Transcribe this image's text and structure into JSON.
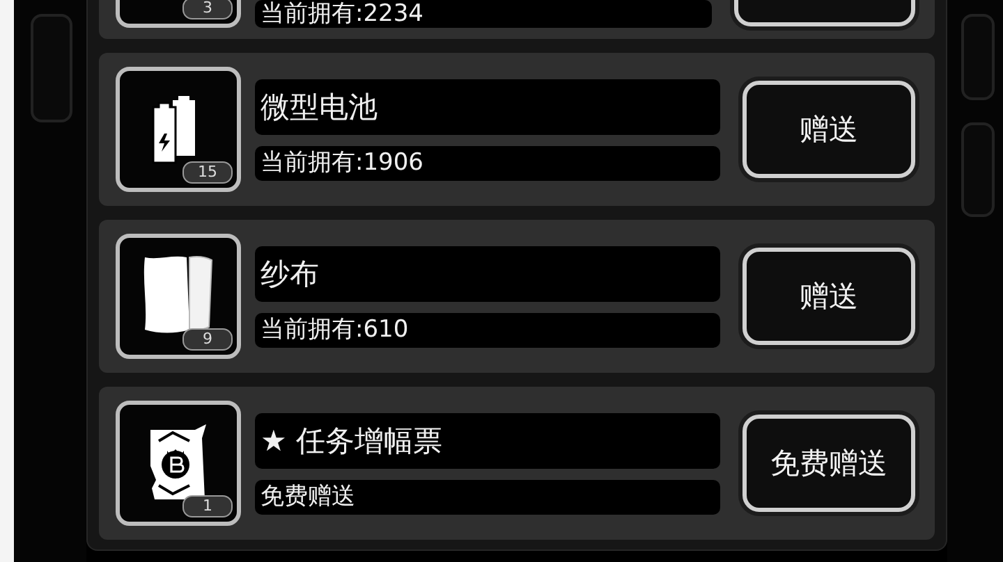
{
  "items": [
    {
      "kind": "partial",
      "owned": "当前拥有:2234",
      "badge": "3"
    },
    {
      "kind": "full",
      "name": "微型电池",
      "owned": "当前拥有:1906",
      "badge": "15",
      "button": "赠送"
    },
    {
      "kind": "full",
      "name": "纱布",
      "owned": "当前拥有:610",
      "badge": "9",
      "button": "赠送"
    },
    {
      "kind": "full",
      "name": "★ 任务增幅票",
      "owned": "免费赠送",
      "badge": "1",
      "button": "免费赠送"
    }
  ]
}
